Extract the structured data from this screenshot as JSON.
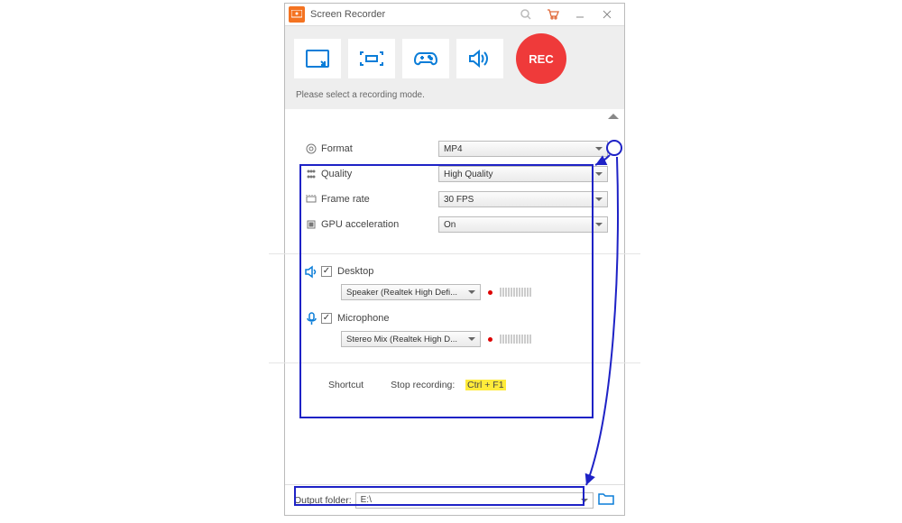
{
  "header": {
    "title": "Screen Recorder"
  },
  "toolbar": {
    "rec_label": "REC"
  },
  "hint": "Please select a recording mode.",
  "settings": {
    "format": {
      "label": "Format",
      "value": "MP4"
    },
    "quality": {
      "label": "Quality",
      "value": "High Quality"
    },
    "fps": {
      "label": "Frame rate",
      "value": "30 FPS"
    },
    "gpu": {
      "label": "GPU acceleration",
      "value": "On"
    }
  },
  "audio": {
    "desktop": {
      "label": "Desktop",
      "device": "Speaker (Realtek High Defi..."
    },
    "microphone": {
      "label": "Microphone",
      "device": "Stereo Mix (Realtek High D..."
    }
  },
  "shortcut": {
    "label": "Shortcut",
    "stop_label": "Stop recording:",
    "stop_keys": "Ctrl + F1"
  },
  "output": {
    "label": "Output folder:",
    "path": "E:\\"
  }
}
